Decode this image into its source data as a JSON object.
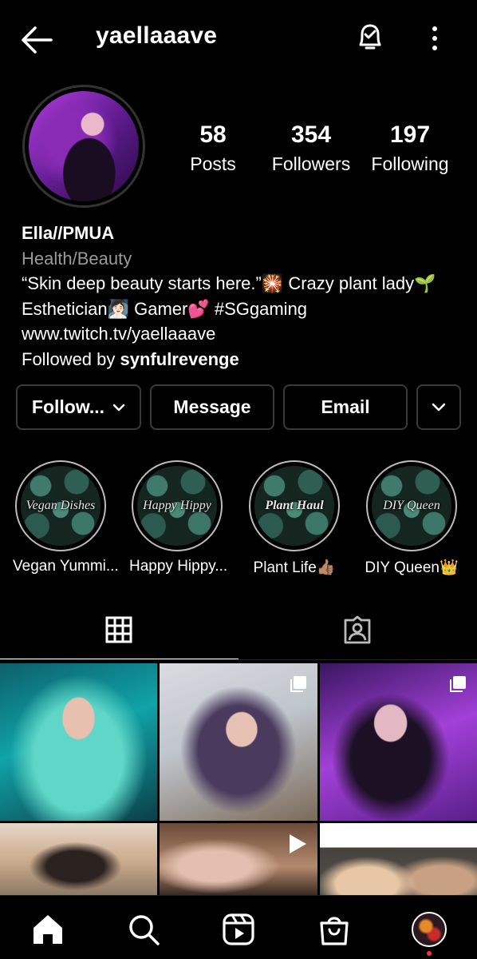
{
  "header": {
    "username": "yaellaaave",
    "back_icon": "arrow-left-icon",
    "bell_icon": "bell-check-icon",
    "more_icon": "more-vertical-icon"
  },
  "stats": {
    "posts": {
      "value": "58",
      "label": "Posts"
    },
    "followers": {
      "value": "354",
      "label": "Followers"
    },
    "following": {
      "value": "197",
      "label": "Following"
    }
  },
  "bio": {
    "name": "Ella//PMUA",
    "category": "Health/Beauty",
    "line1": "“Skin deep beauty starts here.”🎇 Crazy plant lady🌱",
    "line2": "Esthetician🧖🏻‍♀️ Gamer💕 #SGgaming",
    "link": "www.twitch.tv/yaellaaave",
    "followed_by_prefix": "Followed by ",
    "followed_by_user": "synfulrevenge"
  },
  "buttons": {
    "follow": "Follow...",
    "message": "Message",
    "email": "Email"
  },
  "highlights": [
    {
      "cover_text": "Vegan Dishes",
      "label": "Vegan Yummi..."
    },
    {
      "cover_text": "Happy Hippy",
      "label": "Happy Hippy..."
    },
    {
      "cover_text": "Plant Haul",
      "label": "Plant Life👍🏽"
    },
    {
      "cover_text": "DIY Queen",
      "label": "DIY Queen👑"
    }
  ],
  "tabs": {
    "grid_icon": "grid-icon",
    "tagged_icon": "tagged-person-icon",
    "active": "grid"
  },
  "nav": {
    "home_icon": "home-icon",
    "search_icon": "search-icon",
    "reels_icon": "reels-icon",
    "shop_icon": "shop-bag-icon",
    "profile_icon": "profile-avatar-icon"
  },
  "colors": {
    "background": "#000000",
    "button_border": "#3a3a3a",
    "secondary_text": "#9a9a9a",
    "notification_dot": "#ff3040"
  }
}
